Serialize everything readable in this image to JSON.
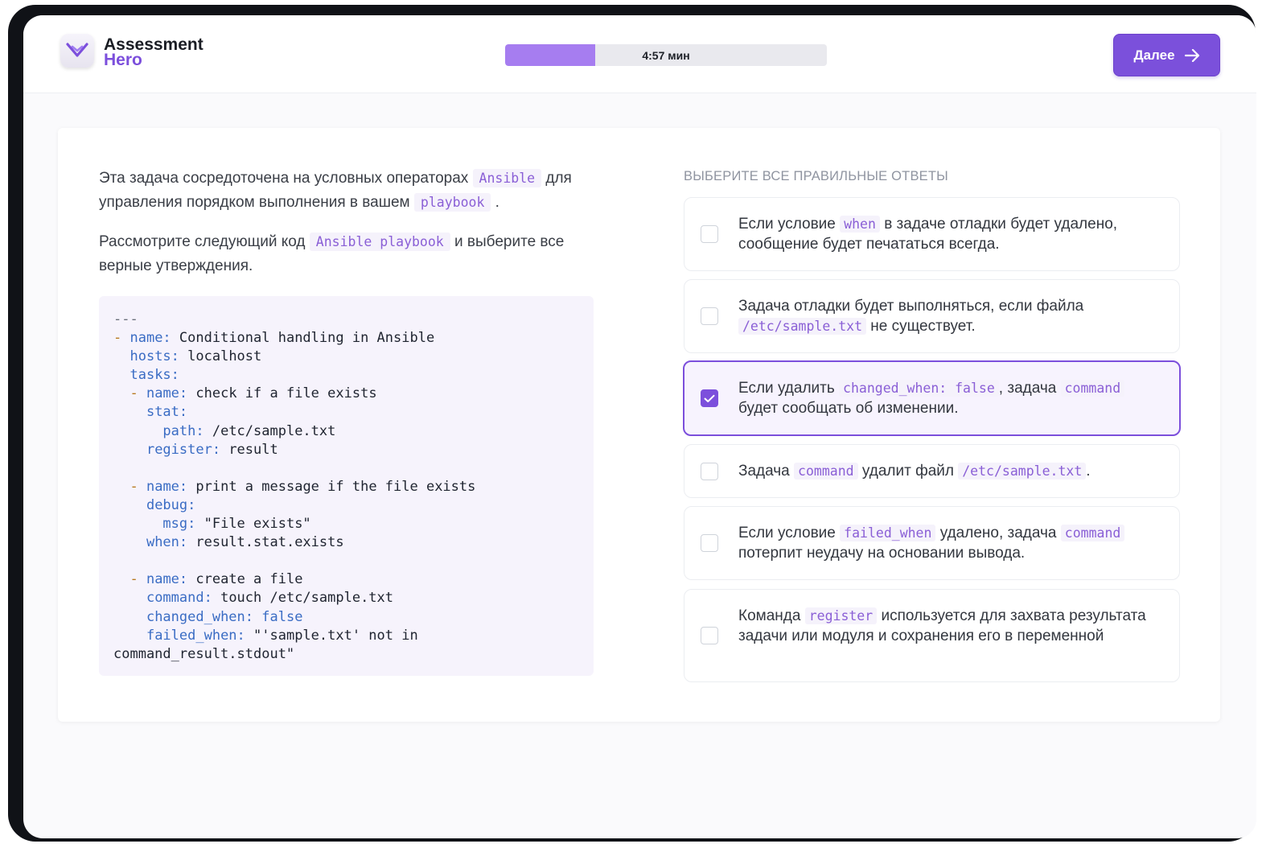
{
  "app": {
    "logo_line1": "Assessment",
    "logo_line2": "Hero"
  },
  "timer": {
    "label": "4:57 мин",
    "progress_fraction": 0.28
  },
  "header": {
    "next_button_label": "Далее"
  },
  "question": {
    "p1_a": "Эта задача сосредоточена на условных операторах",
    "p1_code1": "Ansible",
    "p1_b": "для управления порядком выполнения в вашем",
    "p1_code2": "playbook",
    "p1_c": ".",
    "p2_a": "Рассмотрите следующий код",
    "p2_code": "Ansible playbook",
    "p2_b": "и выберите все верные утверждения."
  },
  "code": {
    "l1": "---",
    "l2_dash": "- ",
    "l2_key": "name:",
    "l2_val": " Conditional handling in Ansible",
    "l3_key": "hosts:",
    "l3_val": " localhost",
    "l4_key": "tasks:",
    "l5_dash": "- ",
    "l5_key": "name:",
    "l5_val": " check if a file exists",
    "l6_key": "stat:",
    "l7_key": "path:",
    "l7_val": " /etc/sample.txt",
    "l8_key": "register:",
    "l8_val": " result",
    "l9_dash": "- ",
    "l9_key": "name:",
    "l9_val": " print a message if the file exists",
    "l10_key": "debug:",
    "l11_key": "msg:",
    "l11_val": " \"File exists\"",
    "l12_key": "when:",
    "l12_val": " result.stat.exists",
    "l13_dash": "- ",
    "l13_key": "name:",
    "l13_val": " create a file",
    "l14_key": "command:",
    "l14_val": " touch /etc/sample.txt",
    "l15_key": "changed_when:",
    "l15_val": " false",
    "l16_key": "failed_when:",
    "l16_val": " \"'sample.txt' not in",
    "l17_val": "command_result.stdout\""
  },
  "answers": {
    "title": "ВЫБЕРИТЕ ВСЕ ПРАВИЛЬНЫЕ ОТВЕТЫ",
    "o1_a": "Если условие",
    "o1_code": "when",
    "o1_b": "в задаче отладки будет удалено, сообщение будет печататься всегда.",
    "o2_a": "Задача отладки будет выполняться, если файла",
    "o2_code": "/etc/sample.txt",
    "o2_b": "не существует.",
    "o3_a": "Если удалить",
    "o3_code1": "changed_when: false",
    "o3_b": ", задача",
    "o3_code2": "command",
    "o3_c": "будет сообщать об изменении.",
    "o4_a": "Задача",
    "o4_code1": "command",
    "o4_b": "удалит файл",
    "o4_code2": "/etc/sample.txt",
    "o4_c": ".",
    "o5_a": "Если условие",
    "o5_code1": "failed_when",
    "o5_b": "удалено, задача",
    "o5_code2": "command",
    "o5_c": "потерпит неудачу на основании вывода.",
    "o6_a": "Команда",
    "o6_code": "register",
    "o6_b": "используется для захвата результата задачи или модуля и сохранения его в переменной",
    "selected": [
      false,
      false,
      true,
      false,
      false,
      false
    ]
  }
}
